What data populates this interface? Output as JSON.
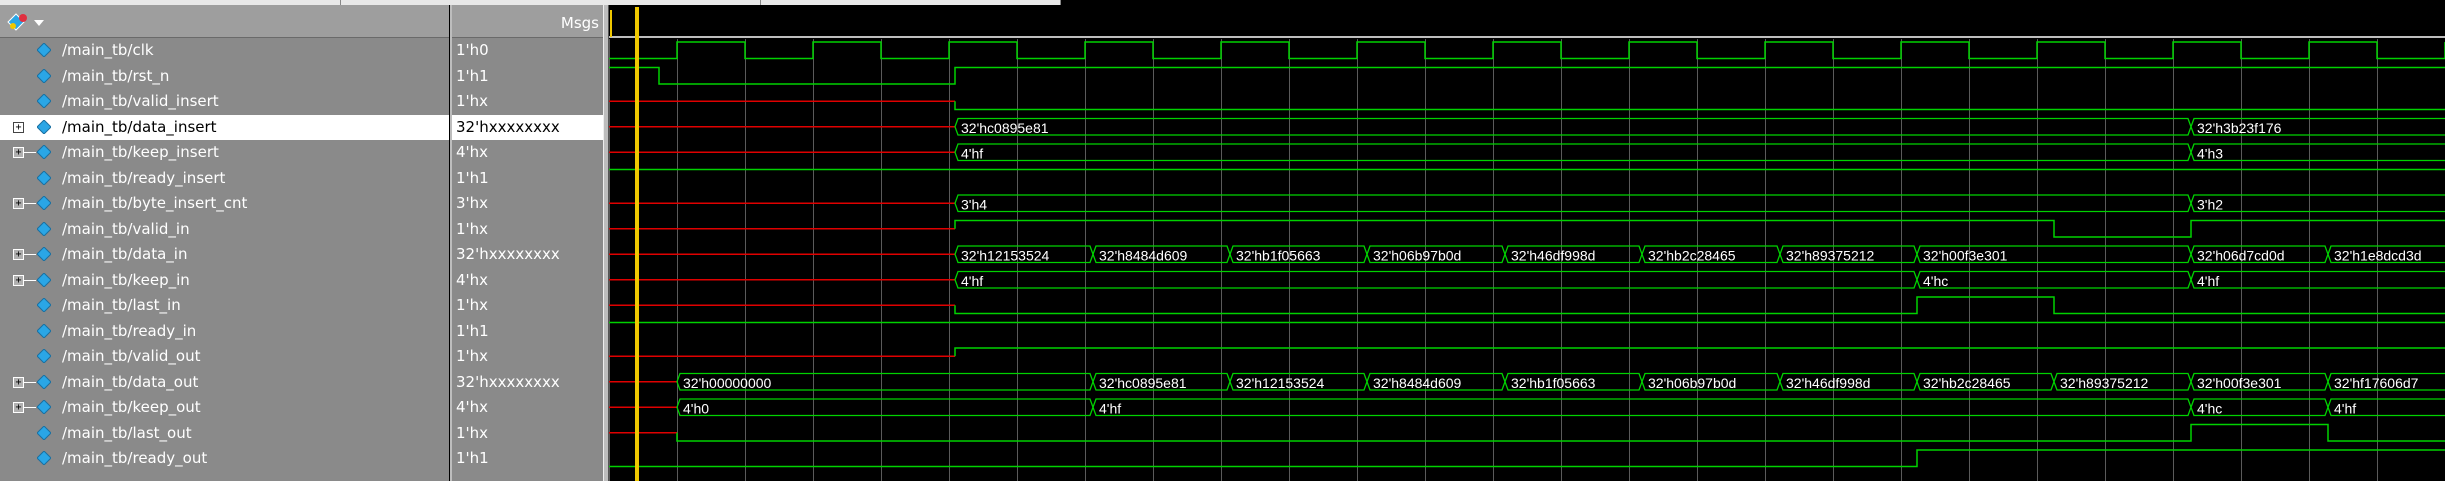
{
  "header": {
    "msgs_label": "Msgs"
  },
  "icons": {
    "app": "wave-app-icon",
    "dropdown": "chevron-down-icon",
    "signal": "signal-diamond-icon"
  },
  "colors": {
    "wave": "#00d200",
    "cursor": "#f0c800",
    "undefined": "#e00000",
    "diamond": "#2aa6e6"
  },
  "signals": [
    {
      "name": "/main_tb/clk",
      "value": "1'h0",
      "bus": false,
      "selected": false
    },
    {
      "name": "/main_tb/rst_n",
      "value": "1'h1",
      "bus": false,
      "selected": false
    },
    {
      "name": "/main_tb/valid_insert",
      "value": "1'hx",
      "bus": false,
      "selected": false
    },
    {
      "name": "/main_tb/data_insert",
      "value": "32'hxxxxxxxx",
      "bus": true,
      "selected": true
    },
    {
      "name": "/main_tb/keep_insert",
      "value": "4'hx",
      "bus": true,
      "selected": false
    },
    {
      "name": "/main_tb/ready_insert",
      "value": "1'h1",
      "bus": false,
      "selected": false
    },
    {
      "name": "/main_tb/byte_insert_cnt",
      "value": "3'hx",
      "bus": true,
      "selected": false
    },
    {
      "name": "/main_tb/valid_in",
      "value": "1'hx",
      "bus": false,
      "selected": false
    },
    {
      "name": "/main_tb/data_in",
      "value": "32'hxxxxxxxx",
      "bus": true,
      "selected": false
    },
    {
      "name": "/main_tb/keep_in",
      "value": "4'hx",
      "bus": true,
      "selected": false
    },
    {
      "name": "/main_tb/last_in",
      "value": "1'hx",
      "bus": false,
      "selected": false
    },
    {
      "name": "/main_tb/ready_in",
      "value": "1'h1",
      "bus": false,
      "selected": false
    },
    {
      "name": "/main_tb/valid_out",
      "value": "1'hx",
      "bus": false,
      "selected": false
    },
    {
      "name": "/main_tb/data_out",
      "value": "32'hxxxxxxxx",
      "bus": true,
      "selected": false
    },
    {
      "name": "/main_tb/keep_out",
      "value": "4'hx",
      "bus": true,
      "selected": false
    },
    {
      "name": "/main_tb/last_out",
      "value": "1'hx",
      "bus": false,
      "selected": false
    },
    {
      "name": "/main_tb/ready_out",
      "value": "1'h1",
      "bus": false,
      "selected": false
    }
  ],
  "waveforms": [
    {
      "signal": "/main_tb/clk",
      "kind": "clock",
      "start": 0,
      "period": 136,
      "first_high": 68,
      "undefined_until": 0
    },
    {
      "signal": "/main_tb/rst_n",
      "kind": "bit",
      "undefined_until": 0,
      "levels": [
        {
          "t": 0,
          "v": 1
        },
        {
          "t": 50,
          "v": 0
        },
        {
          "t": 346,
          "v": 1
        }
      ]
    },
    {
      "signal": "/main_tb/valid_insert",
      "kind": "bit",
      "undefined_until": 346,
      "levels": [
        {
          "t": 346,
          "v": 0
        }
      ]
    },
    {
      "signal": "/main_tb/data_insert",
      "kind": "bus",
      "undefined_until": 346,
      "segments": [
        {
          "t": 346,
          "label": "32'hc0895e81"
        },
        {
          "t": 1582,
          "label": "32'h3b23f176"
        }
      ]
    },
    {
      "signal": "/main_tb/keep_insert",
      "kind": "bus",
      "undefined_until": 346,
      "segments": [
        {
          "t": 346,
          "label": "4'hf"
        },
        {
          "t": 1582,
          "label": "4'h3"
        }
      ]
    },
    {
      "signal": "/main_tb/ready_insert",
      "kind": "bit",
      "undefined_until": 0,
      "levels": [
        {
          "t": 0,
          "v": 1
        }
      ]
    },
    {
      "signal": "/main_tb/byte_insert_cnt",
      "kind": "bus",
      "undefined_until": 346,
      "segments": [
        {
          "t": 346,
          "label": "3'h4"
        },
        {
          "t": 1582,
          "label": "3'h2"
        }
      ]
    },
    {
      "signal": "/main_tb/valid_in",
      "kind": "bit",
      "undefined_until": 346,
      "levels": [
        {
          "t": 346,
          "v": 1
        },
        {
          "t": 1445,
          "v": 0
        },
        {
          "t": 1582,
          "v": 1
        }
      ]
    },
    {
      "signal": "/main_tb/data_in",
      "kind": "bus",
      "undefined_until": 346,
      "segments": [
        {
          "t": 346,
          "label": "32'h12153524"
        },
        {
          "t": 484,
          "label": "32'h8484d609"
        },
        {
          "t": 621,
          "label": "32'hb1f05663"
        },
        {
          "t": 758,
          "label": "32'h06b97b0d"
        },
        {
          "t": 896,
          "label": "32'h46df998d"
        },
        {
          "t": 1033,
          "label": "32'hb2c28465"
        },
        {
          "t": 1171,
          "label": "32'h89375212"
        },
        {
          "t": 1308,
          "label": "32'h00f3e301"
        },
        {
          "t": 1582,
          "label": "32'h06d7cd0d"
        },
        {
          "t": 1719,
          "label": "32'h1e8dcd3d"
        }
      ]
    },
    {
      "signal": "/main_tb/keep_in",
      "kind": "bus",
      "undefined_until": 346,
      "segments": [
        {
          "t": 346,
          "label": "4'hf"
        },
        {
          "t": 1308,
          "label": "4'hc"
        },
        {
          "t": 1582,
          "label": "4'hf"
        }
      ]
    },
    {
      "signal": "/main_tb/last_in",
      "kind": "bit",
      "undefined_until": 346,
      "levels": [
        {
          "t": 346,
          "v": 0
        },
        {
          "t": 1308,
          "v": 1
        },
        {
          "t": 1445,
          "v": 0
        }
      ]
    },
    {
      "signal": "/main_tb/ready_in",
      "kind": "bit",
      "undefined_until": 0,
      "levels": [
        {
          "t": 0,
          "v": 1
        }
      ]
    },
    {
      "signal": "/main_tb/valid_out",
      "kind": "bit",
      "undefined_until": 346,
      "levels": [
        {
          "t": 346,
          "v": 1
        }
      ]
    },
    {
      "signal": "/main_tb/data_out",
      "kind": "bus",
      "undefined_until": 68,
      "segments": [
        {
          "t": 68,
          "label": "32'h00000000"
        },
        {
          "t": 484,
          "label": "32'hc0895e81"
        },
        {
          "t": 621,
          "label": "32'h12153524"
        },
        {
          "t": 758,
          "label": "32'h8484d609"
        },
        {
          "t": 896,
          "label": "32'hb1f05663"
        },
        {
          "t": 1033,
          "label": "32'h06b97b0d"
        },
        {
          "t": 1171,
          "label": "32'h46df998d"
        },
        {
          "t": 1308,
          "label": "32'hb2c28465"
        },
        {
          "t": 1445,
          "label": "32'h89375212"
        },
        {
          "t": 1582,
          "label": "32'h00f3e301"
        },
        {
          "t": 1719,
          "label": "32'hf17606d7"
        }
      ]
    },
    {
      "signal": "/main_tb/keep_out",
      "kind": "bus",
      "undefined_until": 68,
      "segments": [
        {
          "t": 68,
          "label": "4'h0"
        },
        {
          "t": 484,
          "label": "4'hf"
        },
        {
          "t": 1582,
          "label": "4'hc"
        },
        {
          "t": 1719,
          "label": "4'hf"
        }
      ]
    },
    {
      "signal": "/main_tb/last_out",
      "kind": "bit",
      "undefined_until": 68,
      "levels": [
        {
          "t": 68,
          "v": 0
        },
        {
          "t": 1582,
          "v": 1
        },
        {
          "t": 1719,
          "v": 0
        }
      ]
    },
    {
      "signal": "/main_tb/ready_out",
      "kind": "bit",
      "undefined_until": 0,
      "levels": [
        {
          "t": 0,
          "v": 0
        },
        {
          "t": 1308,
          "v": 1
        }
      ]
    }
  ],
  "cursor": {
    "t": 28
  },
  "timeline_end": 1836
}
